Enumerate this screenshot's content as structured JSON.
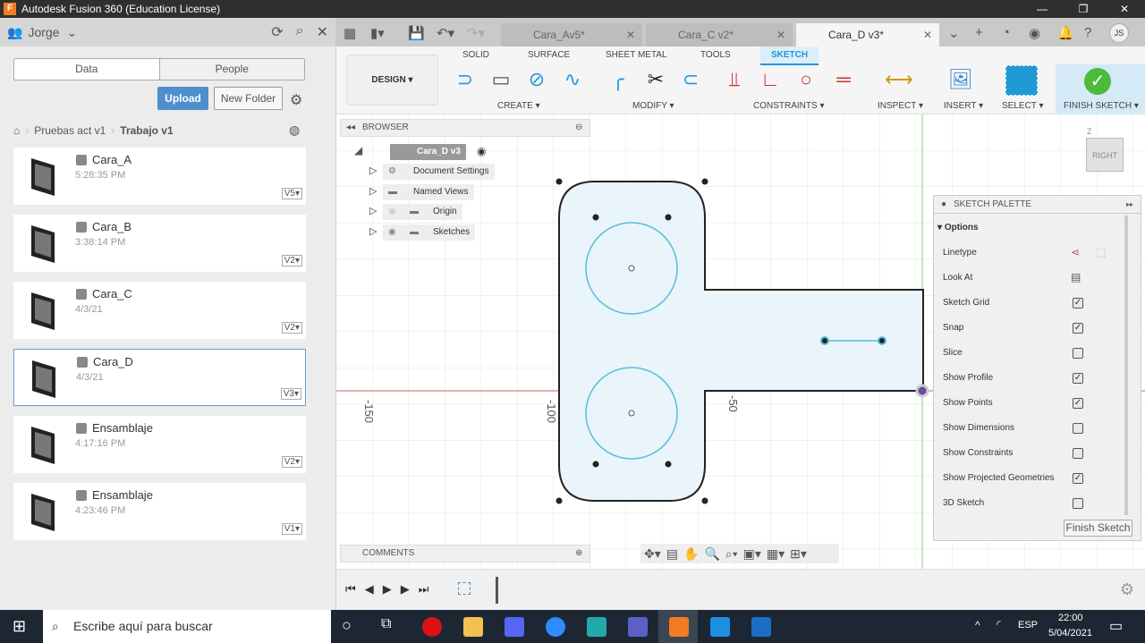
{
  "window": {
    "title": "Autodesk Fusion 360 (Education License)",
    "minimize": "—",
    "maximize": "❐",
    "close": "✕"
  },
  "data_panel": {
    "user": "Jorge",
    "tabs": [
      "Data",
      "People"
    ],
    "upload": "Upload",
    "new_folder": "New Folder",
    "breadcrumb": [
      "Pruebas act v1",
      "Trabajo v1"
    ],
    "files": [
      {
        "name": "Cara_A",
        "time": "5:28:35 PM",
        "version": "V5"
      },
      {
        "name": "Cara_B",
        "time": "3:38:14 PM",
        "version": "V2"
      },
      {
        "name": "Cara_C",
        "time": "4/3/21",
        "version": "V2"
      },
      {
        "name": "Cara_D",
        "time": "4/3/21",
        "version": "V3",
        "selected": true
      },
      {
        "name": "Ensamblaje",
        "time": "4:17:16 PM",
        "version": "V2"
      },
      {
        "name": "Ensamblaje",
        "time": "4:23:46 PM",
        "version": "V1"
      }
    ]
  },
  "doc_tabs": [
    {
      "label": "Cara_Av5*"
    },
    {
      "label": "Cara_C v2*"
    },
    {
      "label": "Cara_D v3*",
      "active": true
    }
  ],
  "user_initials": "JS",
  "toolbar": {
    "workspace": "DESIGN ▾",
    "tabs": [
      "SOLID",
      "SURFACE",
      "SHEET METAL",
      "TOOLS",
      "SKETCH"
    ],
    "active_tab": "SKETCH",
    "groups": [
      "CREATE ▾",
      "MODIFY ▾",
      "CONSTRAINTS ▾",
      "INSPECT ▾",
      "INSERT ▾",
      "SELECT ▾",
      "FINISH SKETCH ▾"
    ],
    "accent": "#1f9ad6"
  },
  "browser": {
    "title": "BROWSER",
    "root": "Cara_D v3",
    "items": [
      "Document Settings",
      "Named Views",
      "Origin",
      "Sketches"
    ]
  },
  "viewcube": {
    "face": "RIGHT",
    "axis": "Z"
  },
  "axis_labels": [
    "-150",
    "-100",
    "-50"
  ],
  "palette": {
    "title": "SKETCH PALETTE",
    "section": "Options",
    "rows": [
      {
        "label": "Linetype"
      },
      {
        "label": "Look At"
      },
      {
        "label": "Sketch Grid",
        "checked": true
      },
      {
        "label": "Snap",
        "checked": true
      },
      {
        "label": "Slice",
        "checked": false
      },
      {
        "label": "Show Profile",
        "checked": true
      },
      {
        "label": "Show Points",
        "checked": true
      },
      {
        "label": "Show Dimensions",
        "checked": false
      },
      {
        "label": "Show Constraints",
        "checked": false
      },
      {
        "label": "Show Projected Geometries",
        "checked": true
      },
      {
        "label": "3D Sketch",
        "checked": false
      }
    ],
    "finish": "Finish Sketch"
  },
  "comments": "COMMENTS",
  "taskbar": {
    "search_placeholder": "Escribe aquí para buscar",
    "lang": "ESP",
    "time": "22:00",
    "date": "5/04/2021"
  }
}
